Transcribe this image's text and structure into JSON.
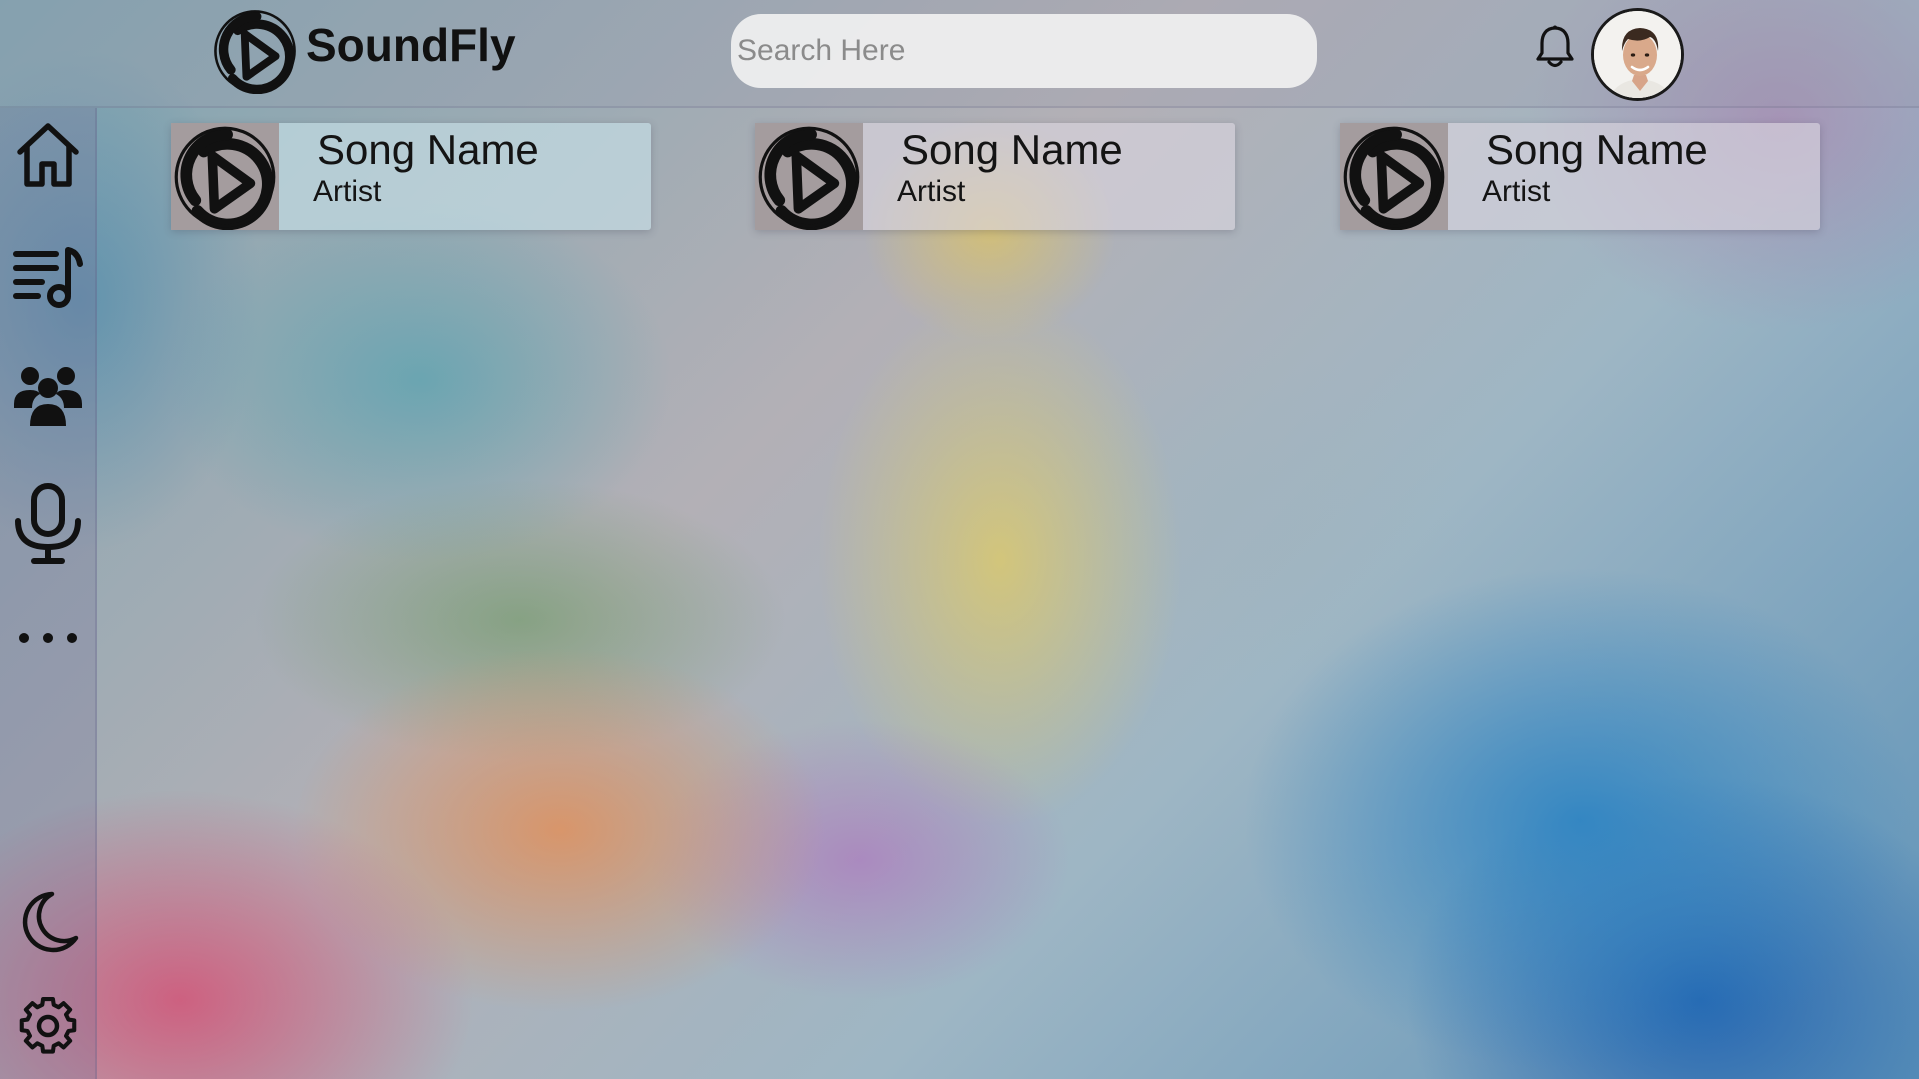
{
  "app": {
    "name": "SoundFly",
    "logo_icon": "play-swirl-logo-icon"
  },
  "header": {
    "search": {
      "placeholder": "Search Here",
      "value": ""
    },
    "notifications_icon": "bell-icon",
    "avatar_icon": "user-avatar"
  },
  "sidebar": {
    "items": [
      {
        "id": "home",
        "icon": "home-icon"
      },
      {
        "id": "playlists",
        "icon": "music-list-icon"
      },
      {
        "id": "community",
        "icon": "users-icon"
      },
      {
        "id": "podcasts",
        "icon": "microphone-icon"
      },
      {
        "id": "more",
        "icon": "more-dots-icon"
      }
    ],
    "bottom_items": [
      {
        "id": "theme",
        "icon": "moon-icon"
      },
      {
        "id": "settings",
        "icon": "gear-icon"
      }
    ]
  },
  "songs": [
    {
      "title": "Song Name",
      "artist": "Artist"
    },
    {
      "title": "Song Name",
      "artist": "Artist"
    },
    {
      "title": "Song Name",
      "artist": "Artist"
    }
  ],
  "colors": {
    "text": "#111111",
    "search_bg": "#f0f0f0",
    "card_art_bg": "#a49c9e"
  }
}
